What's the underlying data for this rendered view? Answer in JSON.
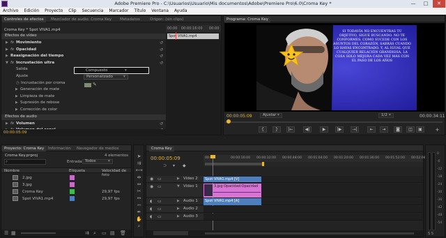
{
  "window": {
    "title": "Adobe Premiere Pro - C:\\Usuarios\\Usuario\\Mis documentos\\Adobe\\Premiere Pro\\6.0\\Croma Key *",
    "min": "—",
    "max": "□",
    "close": "✕"
  },
  "menu": [
    "Archivo",
    "Edición",
    "Proyecto",
    "Clip",
    "Secuencia",
    "Marcador",
    "Título",
    "Ventana",
    "Ayuda"
  ],
  "effect_controls": {
    "tabs": [
      "Controles de efectos",
      "Mezclador de audio: Croma Key",
      "Metadatos",
      "Origen: (sin clips)"
    ],
    "header_left": "Croma Key * Spot VIVA1.mp4",
    "time_labels": [
      "00:00",
      "00:00:16:00",
      "00:00"
    ],
    "clip_label": "Spot VIVA1.mp4",
    "rows": [
      {
        "label": "Efectos de vídeo",
        "kind": "section"
      },
      {
        "label": "Movimiento",
        "kind": "fx",
        "bold": true
      },
      {
        "label": "Opacidad",
        "kind": "fx",
        "bold": true
      },
      {
        "label": "Reasignación del tiempo",
        "kind": "plain",
        "bold": true
      },
      {
        "label": "Incrustación ultra",
        "kind": "fx",
        "bold": true,
        "open": true
      },
      {
        "label": "Salida",
        "kind": "param"
      },
      {
        "label": "Ajuste",
        "kind": "param"
      },
      {
        "label": "Incrustación por croma",
        "kind": "param"
      },
      {
        "label": "Generación de mate",
        "kind": "sub"
      },
      {
        "label": "Limpieza de mate",
        "kind": "sub"
      },
      {
        "label": "Supresión de rebose",
        "kind": "sub"
      },
      {
        "label": "Corrección de color",
        "kind": "sub"
      },
      {
        "label": "Efectos de audio",
        "kind": "section"
      },
      {
        "label": "Volumen",
        "kind": "fx",
        "bold": true
      },
      {
        "label": "Volumen del canal",
        "kind": "fx",
        "bold": true
      }
    ],
    "salida_value": "Compuesto",
    "ajuste_value": "Personalizado",
    "timecode": "00:00:05:09"
  },
  "program": {
    "tab": "Programa: Croma Key",
    "timecode": "00:00:05:09",
    "fit": "Ajustar",
    "scale": "1/2",
    "duration": "00:00:34:11",
    "overlay_text": "SI TODAVÍA NO ENCUENTRAS TU OBJETIVO, SIGUE BUSCANDO. NO TE CONFORMES. COMO SUCEDE CON LOS ASUNTOS DEL CORAZÓN, SABRÁS CUANDO LO HAYAS ENCONTRADO. Y, AL IGUAL QUE CUALQUIER RELACIÓN GRANDIOSA, LA COSA SOLO MEJORA CADA VEZ MÁS CON EL PASO DE LOS AÑOS",
    "controls": [
      "{",
      "}",
      "|←",
      "◀|",
      "▶",
      "|▶",
      "→|",
      "⇤",
      "⇥",
      "◙",
      "◫",
      "▣"
    ],
    "add_btn": "+"
  },
  "project": {
    "tabs": [
      "Proyecto: Croma Key",
      "Información",
      "Navegador de medios"
    ],
    "name": "Croma Key.prproj",
    "count": "4 elementos",
    "entry_label": "Entrada:",
    "entry_value": "Todos",
    "columns": [
      "Nombre",
      "Etiqueta",
      "Velocidad de foto"
    ],
    "items": [
      {
        "name": "2.jpg",
        "label_color": "#c86bc8",
        "fps": ""
      },
      {
        "name": "3.jpg",
        "label_color": "#c86bc8",
        "fps": ""
      },
      {
        "name": "Croma Key",
        "label_color": "#3dbb4e",
        "fps": "29,97 fps"
      },
      {
        "name": "Spot VIVA1.mp4",
        "label_color": "#4d7fbf",
        "fps": "29,97 fps"
      }
    ]
  },
  "timeline": {
    "tab": "Croma Key",
    "timecode": "00:00:05:09",
    "ruler": [
      "00:00",
      "00:00:16:00",
      "00:00:32:00",
      "00:00:48:00",
      "00:01:04:00",
      "00:01:20:00",
      "00:01:36:00",
      "00:01:52:00",
      "00:02:08"
    ],
    "tracks": [
      {
        "name": "Vídeo 2"
      },
      {
        "name": "Vídeo 1"
      },
      {
        "name": "Audio 1"
      },
      {
        "name": "Audio 2"
      },
      {
        "name": "Audio 3"
      }
    ],
    "clip_v2": "Spot VIVA1.mp4 [V]",
    "clip_v1": "3.jpg Opacidad:Opacidad",
    "clip_a1": "Spot VIVA1.mp4 [A]"
  },
  "audio_meter": {
    "db_labels": [
      "0",
      "-6",
      "-12",
      "-18",
      "-24",
      "-30",
      "-36",
      "-42",
      "-48",
      "-54"
    ],
    "footer": "S  S"
  },
  "colors": {
    "accent": "#e8b731",
    "playhead": "#e04545",
    "video_clip": "#4d7fbf",
    "pink_clip": "#d775d4",
    "green_clip": "#3dbb4e"
  }
}
